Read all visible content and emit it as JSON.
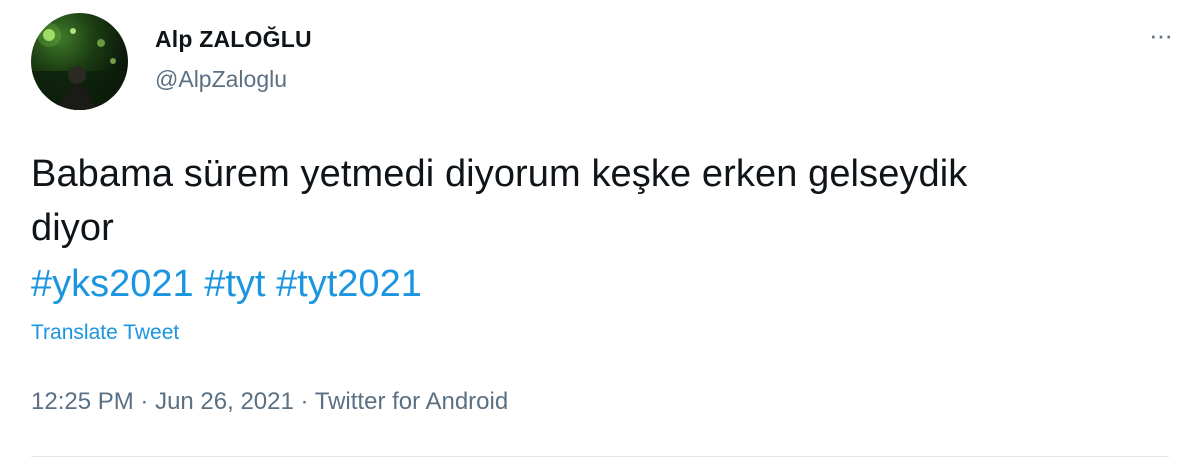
{
  "author": {
    "name": "Alp ZALOĞLU",
    "handle": "@AlpZaloglu",
    "avatar_icon": "profile-photo"
  },
  "tweet": {
    "line1": "Babama sürem yetmedi diyorum keşke erken gelseydik",
    "line2": "diyor",
    "hashtags": [
      "#yks2021",
      "#tyt",
      "#tyt2021"
    ],
    "translate_label": "Translate Tweet"
  },
  "meta": {
    "time": "12:25 PM",
    "separator": " · ",
    "date": "Jun 26, 2021",
    "source": "Twitter for Android"
  },
  "more_icon": "more-horizontal-icon",
  "colors": {
    "link": "#1b95e0",
    "secondary": "#5b7083",
    "text": "#0f1419",
    "divider": "#e1e8ed"
  }
}
